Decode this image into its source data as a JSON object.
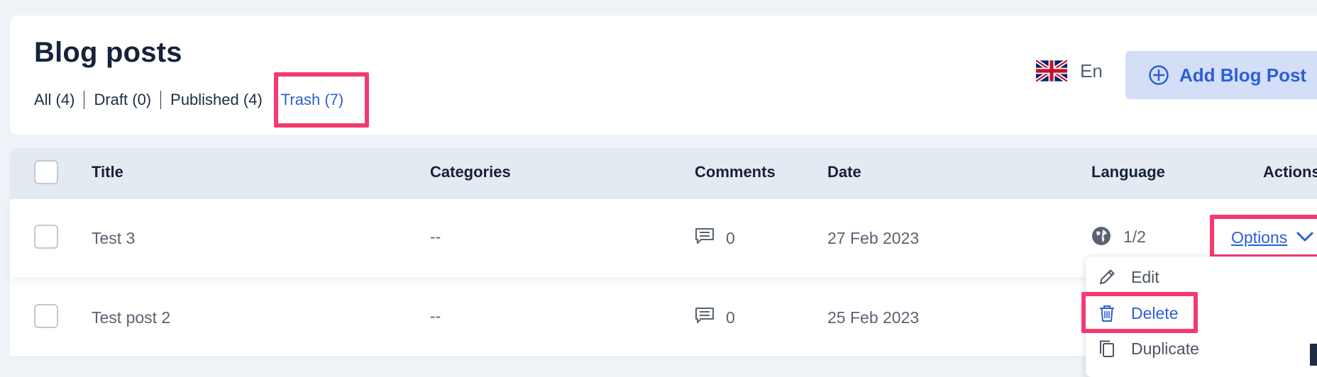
{
  "header": {
    "title": "Blog posts",
    "filters": [
      {
        "label": "All (4)"
      },
      {
        "label": "Draft (0)"
      },
      {
        "label": "Published (4)"
      },
      {
        "label": "Trash (7)"
      }
    ],
    "language": {
      "code": "En",
      "flag_icon": "uk-flag-icon"
    },
    "add_button": {
      "label": "Add Blog Post",
      "icon": "plus-circle-icon"
    }
  },
  "table": {
    "columns": [
      "Title",
      "Categories",
      "Comments",
      "Date",
      "Language",
      "Actions"
    ],
    "rows": [
      {
        "title": "Test 3",
        "categories": "--",
        "comments": "0",
        "date": "27 Feb 2023",
        "language": "1/2",
        "actions": "Options"
      },
      {
        "title": "Test post 2",
        "categories": "--",
        "comments": "0",
        "date": "25 Feb 2023"
      }
    ]
  },
  "options_menu": {
    "items": [
      {
        "label": "Edit",
        "icon": "pencil-icon"
      },
      {
        "label": "Delete",
        "icon": "trash-icon"
      },
      {
        "label": "Duplicate",
        "icon": "duplicate-icon"
      }
    ]
  },
  "colors": {
    "accent": "#2c5fd6",
    "highlight": "#f43a70",
    "background": "#eff3f7",
    "header_row": "#e4eaf1",
    "add_button_bg": "#d4def7"
  }
}
